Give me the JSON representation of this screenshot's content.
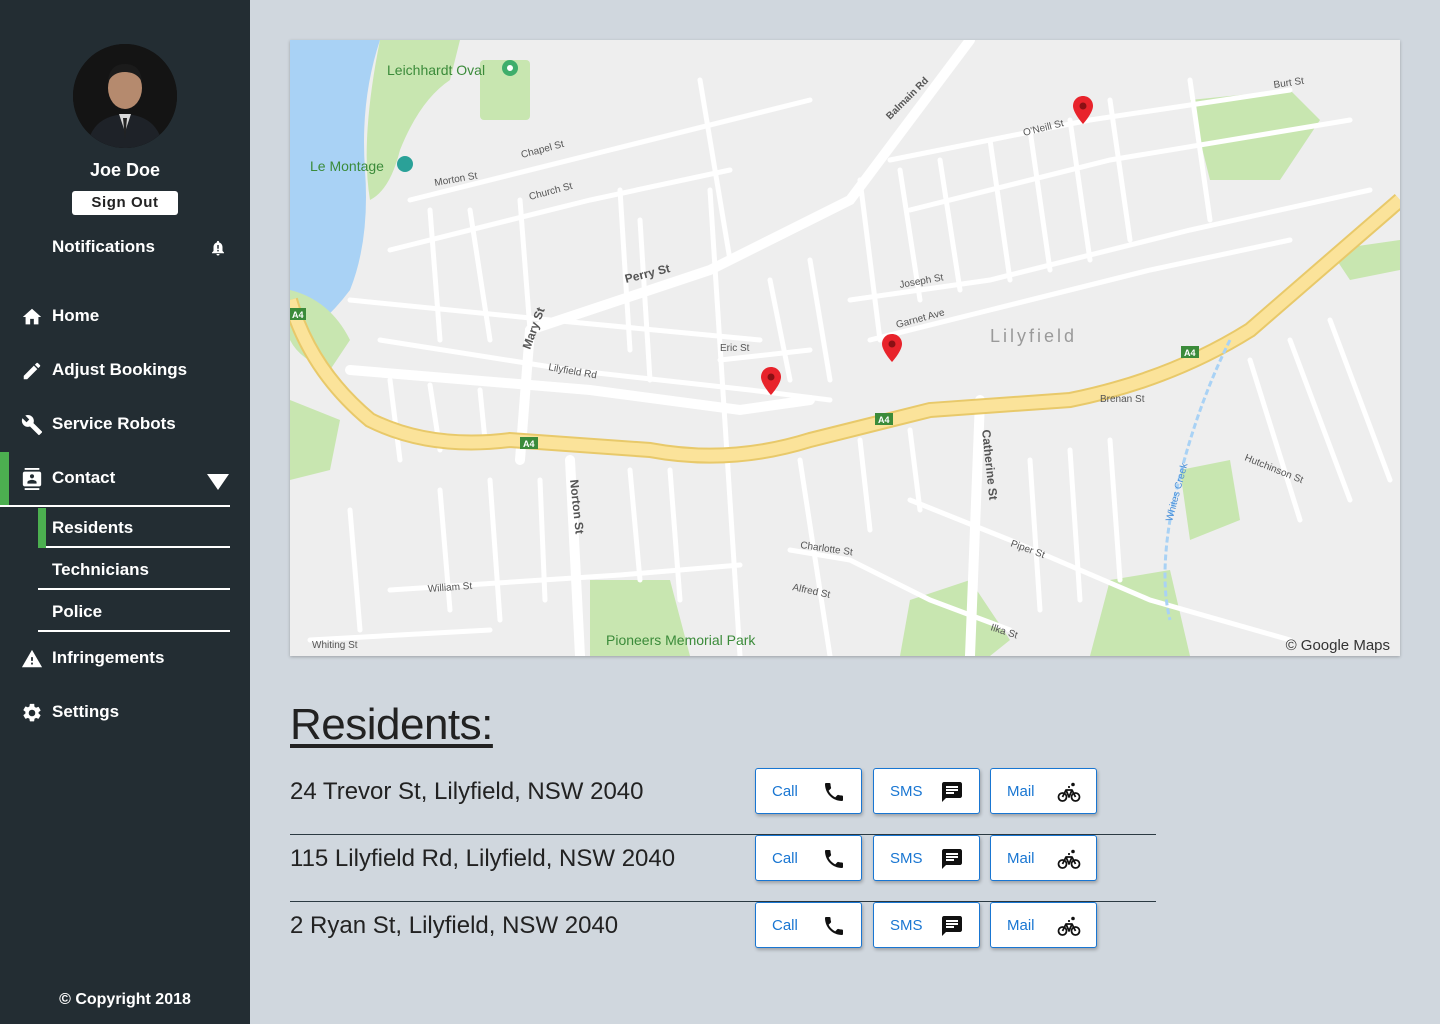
{
  "user": {
    "name": "Joe Doe",
    "signout_label": "Sign Out"
  },
  "notifications": {
    "label": "Notifications",
    "icon": "bell-alert-icon"
  },
  "nav": {
    "items": [
      {
        "label": "Home",
        "icon": "home-icon"
      },
      {
        "label": "Adjust Bookings",
        "icon": "pencil-icon"
      },
      {
        "label": "Service Robots",
        "icon": "wrench-icon"
      },
      {
        "label": "Contact",
        "icon": "contacts-icon",
        "expanded": true,
        "active": true
      },
      {
        "label": "Infringements",
        "icon": "warning-icon"
      },
      {
        "label": "Settings",
        "icon": "gear-icon"
      }
    ],
    "contact_sub": [
      {
        "label": "Residents",
        "active": true
      },
      {
        "label": "Technicians"
      },
      {
        "label": "Police"
      }
    ]
  },
  "footer": {
    "copyright": "© Copyright 2018"
  },
  "map": {
    "credit": "© Google Maps",
    "area_label": "Lilyfield",
    "place_labels": [
      "Leichhardt Oval",
      "Le Montage",
      "Pioneers Memorial Park"
    ],
    "street_labels": [
      "Balmain Rd",
      "Perry St",
      "Mary St",
      "Lilyfield Rd",
      "Norton St",
      "Catherine St",
      "Brenan St",
      "Joseph St",
      "Garnet Ave",
      "Eric St",
      "Chapel St",
      "Church St",
      "Morton St",
      "Piper St",
      "Charlotte St",
      "Alfred St",
      "William St",
      "Whiting St",
      "O'Neill St",
      "Burt St",
      "Hutchinson St",
      "Whites Creek",
      "Ilka St"
    ],
    "road_shield": "A4",
    "pin_color": "#e8232b",
    "road_color": "#fbe39a"
  },
  "residents": {
    "title": "Residents:",
    "rows": [
      {
        "address": "24 Trevor St, Lilyfield, NSW 2040"
      },
      {
        "address": "115 Lilyfield Rd, Lilyfield, NSW 2040"
      },
      {
        "address": "2 Ryan St, Lilyfield, NSW 2040"
      }
    ],
    "buttons": {
      "call": {
        "label": "Call",
        "icon": "phone-icon"
      },
      "sms": {
        "label": "SMS",
        "icon": "message-icon"
      },
      "mail": {
        "label": "Mail",
        "icon": "bicycle-icon"
      }
    }
  },
  "colors": {
    "sidebar": "#232d33",
    "accent": "#4caf50",
    "link": "#1976d2",
    "background": "#d0d7de"
  }
}
